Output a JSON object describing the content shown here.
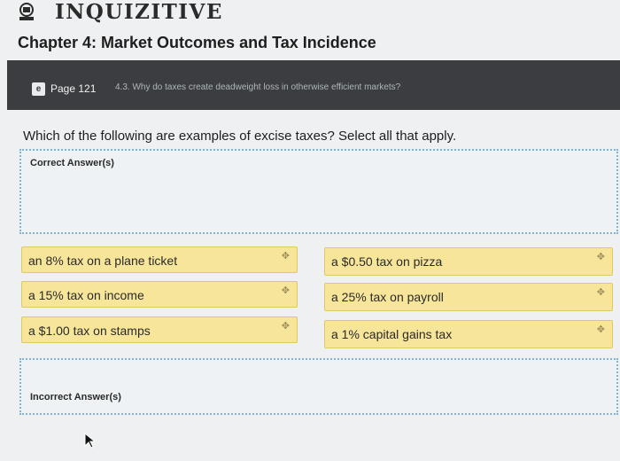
{
  "app": {
    "title": "INQUIZITIVE"
  },
  "chapter": {
    "title": "Chapter 4: Market Outcomes and Tax Incidence"
  },
  "banner": {
    "ebook_icon_glyph": "e",
    "page_label": "Page 121",
    "section_link": "4.3. Why do taxes create deadweight loss in otherwise efficient markets?"
  },
  "question": {
    "text": "Which of the following are examples of excise taxes? Select all that apply."
  },
  "correct_zone": {
    "label": "Correct Answer(s)"
  },
  "incorrect_zone": {
    "label": "Incorrect Answer(s)"
  },
  "answers": {
    "left": [
      {
        "label": "an 8% tax on a plane ticket"
      },
      {
        "label": "a 15% tax on income"
      },
      {
        "label": "a $1.00 tax on stamps"
      }
    ],
    "right": [
      {
        "label": "a $0.50 tax on pizza"
      },
      {
        "label": "a 25% tax on payroll"
      },
      {
        "label": "a 1% capital gains tax"
      }
    ]
  },
  "icons": {
    "logo": "inquizitive-logo-icon",
    "drag": "drag-handle-icon",
    "cursor": "mouse-pointer-icon"
  },
  "colors": {
    "chip_bg": "#f7e59a",
    "banner_bg": "#3b3d40",
    "dropzone_border": "#7fb3d0"
  }
}
